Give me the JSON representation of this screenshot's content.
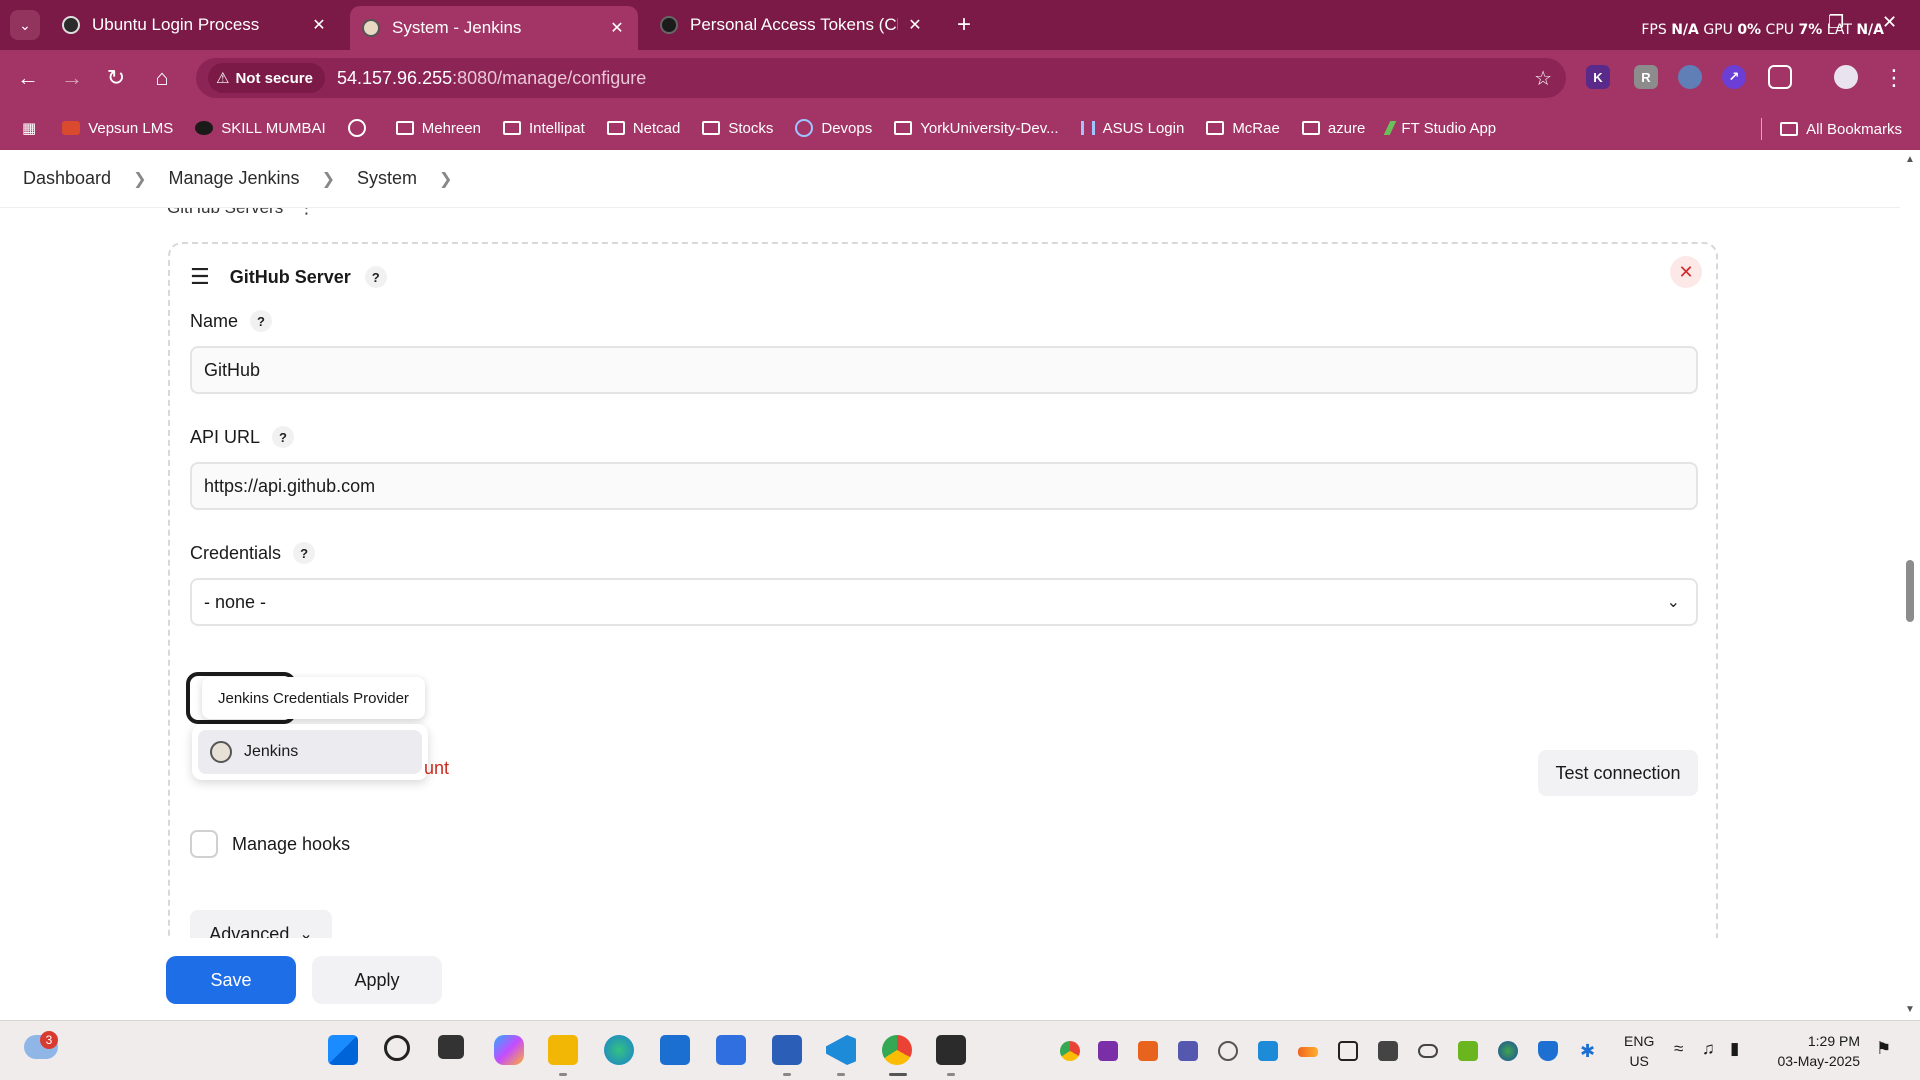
{
  "tabs": [
    {
      "label": "Ubuntu Login Process",
      "active": false
    },
    {
      "label": "System - Jenkins",
      "active": true
    },
    {
      "label": "Personal Access Tokens (Classic)",
      "active": false
    }
  ],
  "perf": {
    "fps_label": "FPS",
    "fps_value": "N/A",
    "gpu_label": "GPU",
    "gpu_value": "0%",
    "cpu_label": "CPU",
    "cpu_value": "7%",
    "lat_label": "LAT",
    "lat_value": "N/A"
  },
  "address": {
    "security": "Not secure",
    "host": "54.157.96.255",
    "path": ":8080/manage/configure"
  },
  "bookmarks": [
    {
      "label": "Vepsun LMS",
      "icon": "vepsun-icon"
    },
    {
      "label": "SKILL MUMBAI",
      "icon": "skill-icon"
    },
    {
      "label": "",
      "icon": "globe-icon"
    },
    {
      "label": "Mehreen",
      "icon": "folder-icon"
    },
    {
      "label": "Intellipat",
      "icon": "folder-icon"
    },
    {
      "label": "Netcad",
      "icon": "folder-icon"
    },
    {
      "label": "Stocks",
      "icon": "folder-icon"
    },
    {
      "label": "Devops",
      "icon": "headset-icon"
    },
    {
      "label": "YorkUniversity-Dev...",
      "icon": "folder-icon"
    },
    {
      "label": "ASUS Login",
      "icon": "signal-icon"
    },
    {
      "label": "McRae",
      "icon": "folder-icon"
    },
    {
      "label": "azure",
      "icon": "folder-icon"
    },
    {
      "label": "FT Studio App",
      "icon": "ft-icon"
    }
  ],
  "all_bookmarks": "All Bookmarks",
  "breadcrumb": [
    "Dashboard",
    "Manage Jenkins",
    "System"
  ],
  "section_title_cut": "GitHub Servers",
  "server": {
    "title": "GitHub Server",
    "help": "?",
    "name_label": "Name",
    "name_value": "GitHub",
    "api_label": "API URL",
    "api_value": "https://api.github.com",
    "cred_label": "Credentials",
    "cred_value": "- none -",
    "tooltip": "Jenkins Credentials Provider",
    "dropdown_item": "Jenkins",
    "error_fragment": "unt",
    "test_button": "Test connection",
    "manage_hooks": "Manage hooks",
    "advanced": "Advanced"
  },
  "actions": {
    "save": "Save",
    "apply": "Apply"
  },
  "taskbar": {
    "notification_count": "3",
    "lang": "ENG",
    "region": "US",
    "time": "1:29 PM",
    "date": "03-May-2025"
  },
  "colors": {
    "chrome": "#7b1a47",
    "toolbar": "#a33566",
    "save": "#1e6ee8",
    "error": "#cc2b1f"
  }
}
